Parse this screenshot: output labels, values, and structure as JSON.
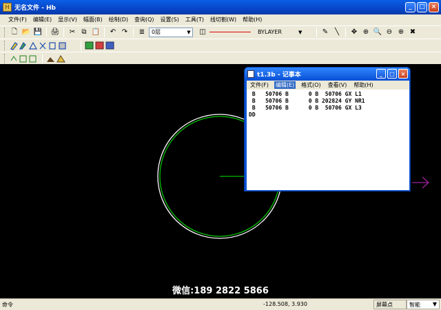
{
  "window": {
    "title": "无名文件 - Hb",
    "minimize_symbol": "_",
    "maximize_symbol": "□",
    "close_symbol": "×"
  },
  "menu": [
    {
      "label": "文件(F)",
      "name": "menu-file"
    },
    {
      "label": "编辑(E)",
      "name": "menu-edit"
    },
    {
      "label": "显示(V)",
      "name": "menu-view"
    },
    {
      "label": "幅面(B)",
      "name": "menu-sheet"
    },
    {
      "label": "绘制(D)",
      "name": "menu-draw"
    },
    {
      "label": "查询(Q)",
      "name": "menu-query"
    },
    {
      "label": "设置(S)",
      "name": "menu-settings"
    },
    {
      "label": "工具(T)",
      "name": "menu-tools"
    },
    {
      "label": "线切割(W)",
      "name": "menu-wirecut"
    },
    {
      "label": "帮助(H)",
      "name": "menu-help"
    }
  ],
  "toolbar": {
    "layer_value": "0层",
    "linetype_value": "BYLAYER",
    "dropdown_arrow": "▼"
  },
  "icons": {
    "new": "🗋",
    "open": "📂",
    "save": "💾",
    "print": "🖨",
    "cut": "✂",
    "copy": "⧉",
    "paste": "📋",
    "undo": "↶",
    "redo": "↷",
    "layers": "≣",
    "linetype": "◫",
    "pen": "✎",
    "line": "╲",
    "zoom_window": "⊕",
    "zoom_in": "🔍",
    "zoom_out": "⊖",
    "pan": "✥",
    "close_x": "✖"
  },
  "canvas": {
    "watermark": "微信:189 2822 5866",
    "circle_color": "#00c000",
    "arrow_color": "#a020a0"
  },
  "status": {
    "command_label": "命令",
    "coordinates": "-128.508, 3.930",
    "snap_mode": "屏幕点",
    "smart_mode": "智能",
    "smart_arrow": "▼"
  },
  "notepad": {
    "title": "t1.3b - 记事本",
    "menu": [
      {
        "label": "文件(F)",
        "name": "np-menu-file",
        "active": false
      },
      {
        "label": "编辑(E)",
        "name": "np-menu-edit",
        "active": true
      },
      {
        "label": "格式(O)",
        "name": "np-menu-format",
        "active": false
      },
      {
        "label": "查看(V)",
        "name": "np-menu-view",
        "active": false
      },
      {
        "label": "帮助(H)",
        "name": "np-menu-help",
        "active": false
      }
    ],
    "lines": [
      " B   50706 B      0 B  50706 GX L1",
      " B   50706 B      0 B 202824 GY NR1",
      " B   50706 B      0 B  50706 GX L3",
      "DD"
    ]
  }
}
